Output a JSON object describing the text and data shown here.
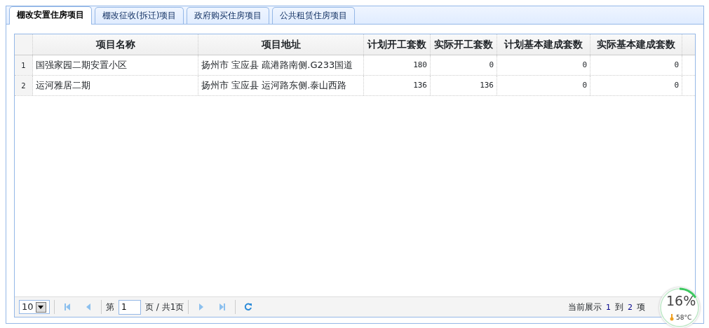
{
  "tabs": [
    {
      "label": "棚改安置住房项目",
      "selected": true
    },
    {
      "label": "棚改征收(拆迁)项目",
      "selected": false
    },
    {
      "label": "政府购买住房项目",
      "selected": false
    },
    {
      "label": "公共租赁住房项目",
      "selected": false
    }
  ],
  "table": {
    "columns": [
      "项目名称",
      "项目地址",
      "计划开工套数",
      "实际开工套数",
      "计划基本建成套数",
      "实际基本建成套数"
    ],
    "rows": [
      {
        "index": "1",
        "cells": [
          "国强家园二期安置小区",
          "扬州市 宝应县 疏港路南侧.G233国道",
          "180",
          "0",
          "0",
          "0"
        ]
      },
      {
        "index": "2",
        "cells": [
          "运河雅居二期",
          "扬州市 宝应县 运河路东侧.泰山西路",
          "136",
          "136",
          "0",
          "0"
        ]
      }
    ]
  },
  "pager": {
    "page_size": "10",
    "page_prefix": "第",
    "page": "1",
    "page_suffix": "页 / 共1页",
    "summary": [
      "当前展示",
      "1",
      "到",
      "2",
      "项"
    ]
  },
  "monitor": {
    "reading": "16%",
    "temperature": "58°C",
    "level": 0.16
  }
}
